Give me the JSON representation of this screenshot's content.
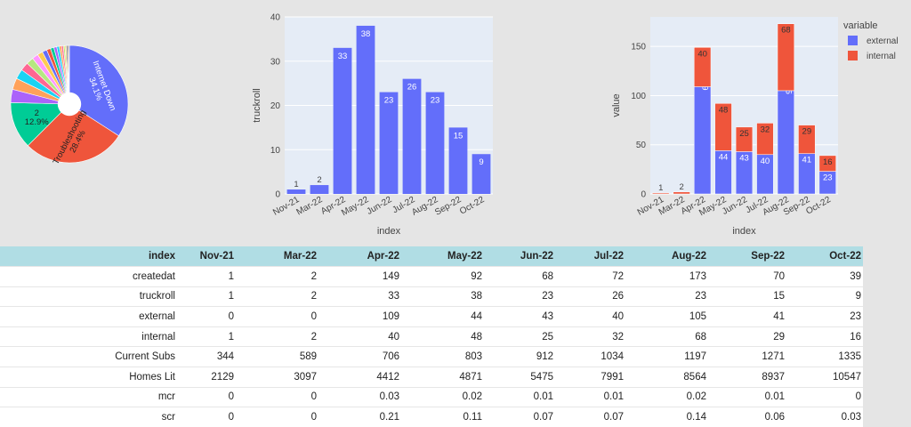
{
  "chart_data": [
    {
      "type": "pie",
      "labels": [
        "Internet Down",
        "Troubleshooting",
        "2"
      ],
      "values": [
        34.1,
        28.4,
        12.9
      ],
      "slice_labels": [
        "Internet Down\n34.1%",
        "Troubleshooting\n28.4%",
        "2\n12.9%"
      ],
      "colors": [
        "#636efa",
        "#ef553b",
        "#00cc96"
      ],
      "other_share": 24.6,
      "hole": 0.2
    },
    {
      "type": "bar",
      "categories": [
        "Nov-21",
        "Mar-22",
        "Apr-22",
        "May-22",
        "Jun-22",
        "Jul-22",
        "Aug-22",
        "Sep-22",
        "Oct-22"
      ],
      "values": [
        1,
        2,
        33,
        38,
        23,
        26,
        23,
        15,
        9
      ],
      "xlabel": "index",
      "ylabel": "truckroll",
      "ylim": [
        0,
        40
      ],
      "yticks": [
        0,
        10,
        20,
        30,
        40
      ],
      "color": "#636efa",
      "grid": true
    },
    {
      "type": "bar",
      "stacked": true,
      "categories": [
        "Nov-21",
        "Mar-22",
        "Apr-22",
        "May-22",
        "Jun-22",
        "Jul-22",
        "Aug-22",
        "Sep-22",
        "Oct-22"
      ],
      "series": [
        {
          "name": "external",
          "values": [
            0,
            0,
            109,
            44,
            43,
            40,
            105,
            41,
            23
          ],
          "color": "#636efa"
        },
        {
          "name": "internal",
          "values": [
            1,
            2,
            40,
            48,
            25,
            32,
            68,
            29,
            16
          ],
          "color": "#ef553b"
        }
      ],
      "xlabel": "index",
      "ylabel": "value",
      "ylim": [
        0,
        180
      ],
      "yticks": [
        0,
        50,
        100,
        150
      ],
      "legend_title": "variable",
      "legend_position": "top-right",
      "grid": true
    }
  ],
  "table": {
    "columns": [
      "index",
      "Nov-21",
      "Mar-22",
      "Apr-22",
      "May-22",
      "Jun-22",
      "Jul-22",
      "Aug-22",
      "Sep-22",
      "Oct-22"
    ],
    "rows": [
      [
        "createdat",
        "1",
        "2",
        "149",
        "92",
        "68",
        "72",
        "173",
        "70",
        "39"
      ],
      [
        "truckroll",
        "1",
        "2",
        "33",
        "38",
        "23",
        "26",
        "23",
        "15",
        "9"
      ],
      [
        "external",
        "0",
        "0",
        "109",
        "44",
        "43",
        "40",
        "105",
        "41",
        "23"
      ],
      [
        "internal",
        "1",
        "2",
        "40",
        "48",
        "25",
        "32",
        "68",
        "29",
        "16"
      ],
      [
        "Current Subs",
        "344",
        "589",
        "706",
        "803",
        "912",
        "1034",
        "1197",
        "1271",
        "1335"
      ],
      [
        "Homes Lit",
        "2129",
        "3097",
        "4412",
        "4871",
        "5475",
        "7991",
        "8564",
        "8937",
        "10547"
      ],
      [
        "mcr",
        "0",
        "0",
        "0.03",
        "0.02",
        "0.01",
        "0.01",
        "0.02",
        "0.01",
        "0"
      ],
      [
        "scr",
        "0",
        "0",
        "0.21",
        "0.11",
        "0.07",
        "0.07",
        "0.14",
        "0.06",
        "0.03"
      ]
    ]
  }
}
